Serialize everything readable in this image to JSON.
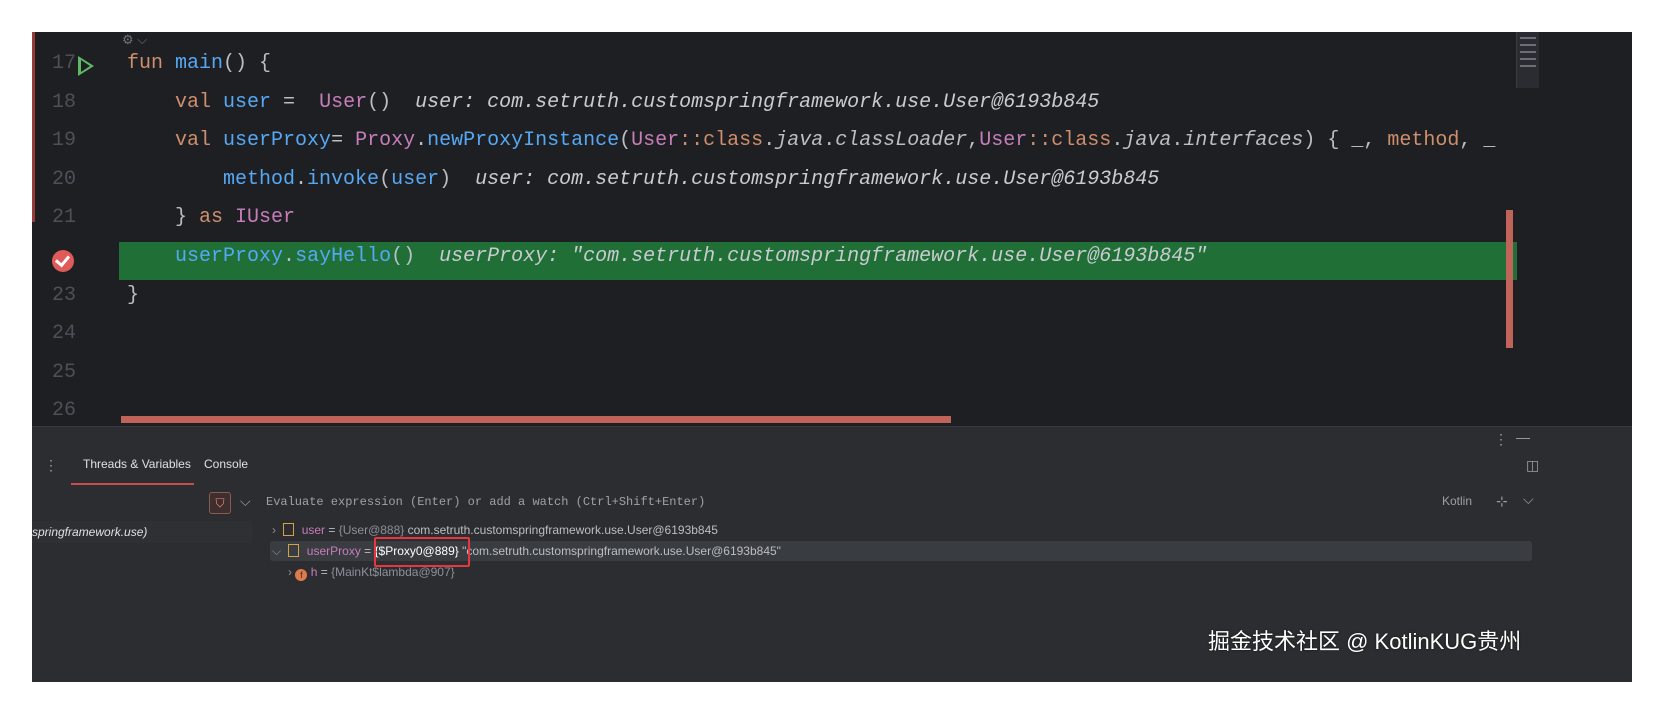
{
  "editor": {
    "inlay_top": "⚙ ⌵",
    "lines": [
      {
        "no": "17",
        "parts": [
          [
            "kw",
            "fun "
          ],
          [
            "fn",
            "main"
          ],
          [
            "p",
            "() {"
          ]
        ]
      },
      {
        "no": "18",
        "parts": [
          [
            "p",
            "    "
          ],
          [
            "kw",
            "val "
          ],
          [
            "fn",
            "user"
          ],
          [
            "p",
            " = "
          ],
          [
            "cls",
            " User"
          ],
          [
            "p",
            "()"
          ]
        ],
        "hint": "user: com.setruth.customspringframework.use.User@6193b845"
      },
      {
        "no": "19",
        "parts": [
          [
            "p",
            "    "
          ],
          [
            "kw",
            "val "
          ],
          [
            "fn",
            "userProxy"
          ],
          [
            "p",
            "= "
          ],
          [
            "cls",
            "Proxy"
          ],
          [
            "p",
            "."
          ],
          [
            "fn",
            "newProxyInstance"
          ],
          [
            "p",
            "("
          ],
          [
            "cls",
            "User"
          ],
          [
            "kw",
            "::class"
          ],
          [
            "p",
            "."
          ],
          [
            "it",
            "java"
          ],
          [
            "p",
            "."
          ],
          [
            "it",
            "classLoader"
          ],
          [
            "p",
            ","
          ],
          [
            "cls",
            "User"
          ],
          [
            "kw",
            "::class"
          ],
          [
            "p",
            "."
          ],
          [
            "it",
            "java"
          ],
          [
            "p",
            "."
          ],
          [
            "it",
            "interfaces"
          ],
          [
            "p",
            ") { _, "
          ],
          [
            "kw",
            "method"
          ],
          [
            "p",
            ", _"
          ]
        ]
      },
      {
        "no": "20",
        "parts": [
          [
            "p",
            "        "
          ],
          [
            "fn",
            "method"
          ],
          [
            "p",
            "."
          ],
          [
            "fn",
            "invoke"
          ],
          [
            "p",
            "("
          ],
          [
            "fn",
            "user"
          ],
          [
            "p",
            ")"
          ]
        ],
        "hint": "user: com.setruth.customspringframework.use.User@6193b845"
      },
      {
        "no": "21",
        "parts": [
          [
            "p",
            "    } "
          ],
          [
            "kw",
            "as "
          ],
          [
            "cls",
            "IUser"
          ]
        ]
      },
      {
        "no": "",
        "parts": [
          [
            "p",
            "    "
          ],
          [
            "fn",
            "userProxy"
          ],
          [
            "p",
            "."
          ],
          [
            "fn",
            "sayHello"
          ],
          [
            "p",
            "()"
          ]
        ],
        "hint": "userProxy: \"com.setruth.customspringframework.use.User@6193b845\""
      },
      {
        "no": "23",
        "parts": [
          [
            "p",
            "}"
          ]
        ]
      },
      {
        "no": "24",
        "parts": []
      },
      {
        "no": "25",
        "parts": []
      },
      {
        "no": "26",
        "parts": []
      }
    ]
  },
  "panel": {
    "tabs": [
      "Threads & Variables",
      "Console"
    ],
    "eval_placeholder": "Evaluate expression (Enter) or add a watch (Ctrl+Shift+Enter)",
    "language": "Kotlin",
    "frame": "springframework.use)",
    "vars": [
      {
        "name": "user",
        "eq": " = ",
        "ref": "{User@888}",
        "val": " com.setruth.customspringframework.use.User@6193b845"
      },
      {
        "name": "userProxy",
        "eq": " = ",
        "ref": "{$Proxy0@889}",
        "val": " \"com.setruth.customspringframework.use.User@6193b845\""
      },
      {
        "name": "h",
        "eq": " = ",
        "ref": "{MainKt$lambda@907}",
        "val": ""
      }
    ]
  },
  "watermark": "掘金技术社区 @ KotlinKUG贵州",
  "colors": {
    "current_line": "#1f6f37",
    "breakpoint": "#e05a5a",
    "highlight_box": "#e8363e"
  }
}
